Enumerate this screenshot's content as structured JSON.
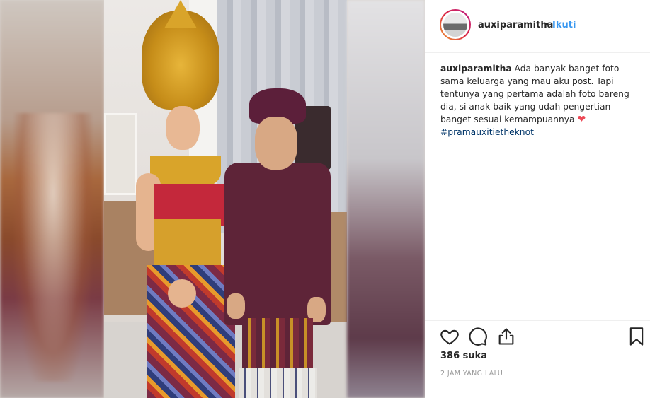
{
  "post": {
    "username": "auxiparamitha",
    "separator": "•",
    "follow_label": "Ikuti",
    "caption_user": "auxiparamitha",
    "caption_text": "Ada banyak banget foto sama keluarga yang mau aku post. Tapi tentunya yang pertama adalah foto bareng dia, si anak baik yang udah pengertian banget sesuai kemampuannya",
    "caption_emoji": "❤",
    "hashtag": "#pramauxitietheknot",
    "likes": "386 suka",
    "timestamp": "2 JAM YANG LALU"
  },
  "icons": {
    "like": "heart-outline-icon",
    "comment": "speech-bubble-icon",
    "share": "share-upload-icon",
    "save": "bookmark-icon"
  },
  "colors": {
    "follow": "#3897f0",
    "hashtag": "#003569",
    "heart": "#ed4956"
  }
}
